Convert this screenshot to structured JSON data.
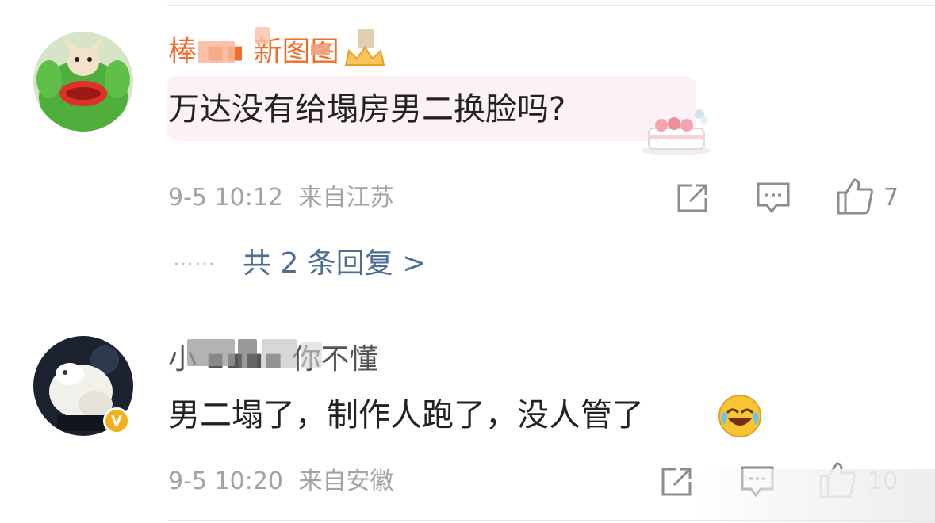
{
  "comments": [
    {
      "username": "棒 ▪▪ 新图图",
      "text": "万达没有给塌房男二换脸吗?",
      "time": "9-5 10:12",
      "location": "来自江苏",
      "likes": "7",
      "replies_label": "共 2 条回复 >",
      "username_color": "#f26b2a"
    },
    {
      "username": "小 ▪▪▪▪ 你不懂",
      "text": "男二塌了，制作人跑了，没人管了",
      "time": "9-5 10:20",
      "location": "来自安徽",
      "likes": "10",
      "verified_badge": "V",
      "username_color": "#555555"
    }
  ],
  "icons": {
    "share": "share-icon",
    "comment": "comment-icon",
    "like": "thumbs-up-icon",
    "emoji": "laughing-crying-emoji-icon"
  },
  "colors": {
    "reply_link": "#4e6d96",
    "meta_text": "#a3a3a3",
    "bubble_bg": "#fbf1f6"
  }
}
